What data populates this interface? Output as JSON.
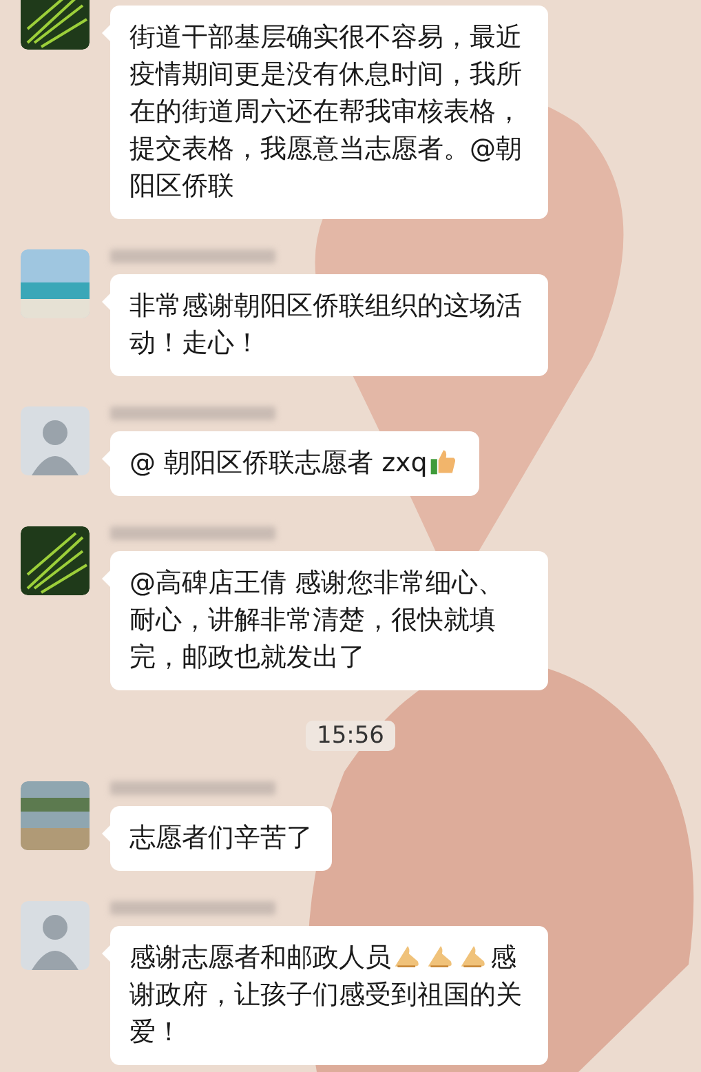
{
  "messages": [
    {
      "kind": "message",
      "avatar": {
        "kind": "leaf"
      },
      "name_visible": false,
      "parts": [
        {
          "kind": "text",
          "text": "街道干部基层确实很不容易，最近疫情期间更是没有休息时间，我所在的街道周六还在帮我审核表格，提交表格，我愿意当志愿者。@朝阳区侨联"
        }
      ]
    },
    {
      "kind": "message",
      "avatar": {
        "kind": "beach"
      },
      "name_visible": true,
      "parts": [
        {
          "kind": "text",
          "text": "非常感谢朝阳区侨联组织的这场活动！走心！"
        }
      ]
    },
    {
      "kind": "message",
      "avatar": {
        "kind": "person"
      },
      "name_visible": true,
      "parts": [
        {
          "kind": "text",
          "text": "@  朝阳区侨联志愿者 zxq"
        },
        {
          "kind": "thumbs"
        }
      ]
    },
    {
      "kind": "message",
      "avatar": {
        "kind": "leaf"
      },
      "name_visible": true,
      "parts": [
        {
          "kind": "text",
          "text": "@高碑店王倩 感谢您非常细心、耐心，讲解非常清楚，很快就填完，邮政也就发出了"
        }
      ]
    },
    {
      "kind": "time",
      "text": "15:56"
    },
    {
      "kind": "message",
      "avatar": {
        "kind": "group"
      },
      "name_visible": true,
      "parts": [
        {
          "kind": "text",
          "text": "志愿者们辛苦了"
        }
      ]
    },
    {
      "kind": "message",
      "avatar": {
        "kind": "person"
      },
      "name_visible": true,
      "parts": [
        {
          "kind": "text",
          "text": "感谢志愿者和邮政人员"
        },
        {
          "kind": "hands"
        },
        {
          "kind": "hands"
        },
        {
          "kind": "hands"
        },
        {
          "kind": "text",
          "text": "感"
        },
        {
          "kind": "block",
          "text": "谢政府，让孩子们感受到祖国的关爱！"
        }
      ]
    }
  ]
}
